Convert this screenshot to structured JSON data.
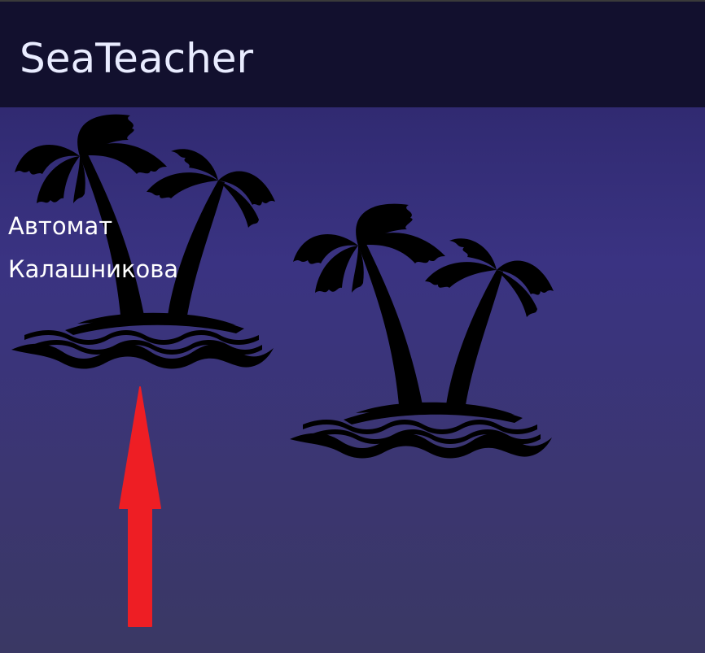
{
  "header": {
    "app_title": "SeaTeacher",
    "background": "#12102e"
  },
  "islands": [
    {
      "label": "Автомат Калашникова",
      "icon": "palm-island-icon"
    },
    {
      "label": "",
      "icon": "palm-island-icon"
    }
  ],
  "pointer": {
    "icon": "up-arrow-icon",
    "color": "#ee1e24"
  },
  "colors": {
    "sky_top": "#2a2466",
    "sky_bottom": "#3a3864",
    "island_fill": "#000000"
  }
}
